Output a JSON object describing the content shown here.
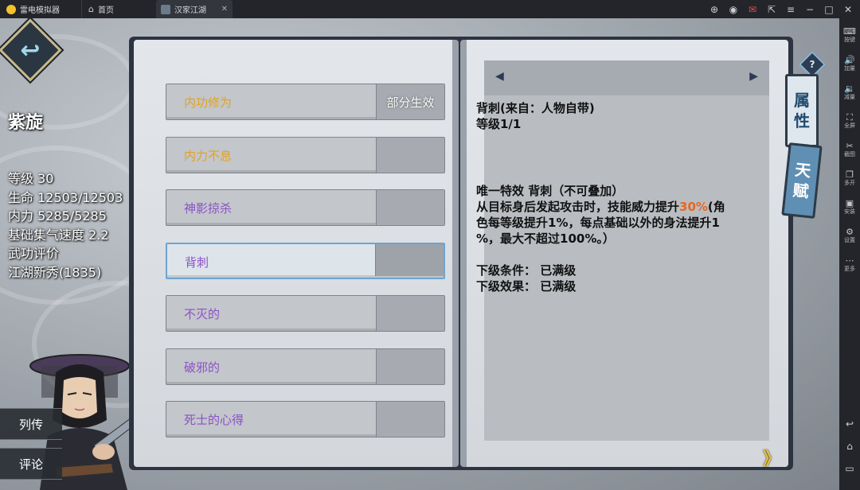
{
  "titlebar": {
    "app_name": "雷电模拟器",
    "home_tab": "首页",
    "game_tab": "汉家江湖",
    "close_glyph": "✕"
  },
  "sidebar": {
    "items": [
      {
        "icon": "keyboard-icon",
        "glyph": "⌨",
        "label": "按键"
      },
      {
        "icon": "volume-up-icon",
        "glyph": "🔊",
        "label": "加量"
      },
      {
        "icon": "volume-down-icon",
        "glyph": "🔉",
        "label": "减量"
      },
      {
        "icon": "fullscreen-icon",
        "glyph": "⛶",
        "label": "全屏"
      },
      {
        "icon": "scissors-icon",
        "glyph": "✂",
        "label": "截图"
      },
      {
        "icon": "multi-open-icon",
        "glyph": "❐",
        "label": "多开"
      },
      {
        "icon": "apk-install-icon",
        "glyph": "▣",
        "label": "安装"
      },
      {
        "icon": "gear-icon",
        "glyph": "⚙",
        "label": "设置"
      },
      {
        "icon": "more-icon",
        "glyph": "⋯",
        "label": "更多"
      }
    ],
    "nav": {
      "back": "↩",
      "home": "⌂",
      "recent": "▭"
    }
  },
  "game": {
    "back_glyph": "↩",
    "character": {
      "name": "紫旋",
      "stats": [
        "等级 30",
        "生命 12503/12503",
        "内力 5285/5285",
        "基础集气速度 2.2",
        "武功评价",
        "江湖新秀(1835)"
      ]
    },
    "side_buttons": {
      "bio": "列传",
      "comment": "评论"
    },
    "skills": [
      {
        "name": "内功修为",
        "status": "部分生效",
        "color": "#e3a21f",
        "selected": false
      },
      {
        "name": "内力不息",
        "status": "",
        "color": "#e3a21f",
        "selected": false
      },
      {
        "name": "神影掠杀",
        "status": "",
        "color": "#8a52c8",
        "selected": false
      },
      {
        "name": "背刺",
        "status": "",
        "color": "#8a52c8",
        "selected": true
      },
      {
        "name": "不灭的",
        "status": "",
        "color": "#8a52c8",
        "selected": false
      },
      {
        "name": "破邪的",
        "status": "",
        "color": "#8a52c8",
        "selected": false
      },
      {
        "name": "死士的心得",
        "status": "",
        "color": "#8a52c8",
        "selected": false
      }
    ],
    "detail": {
      "prev_glyph": "◀",
      "next_glyph": "▶",
      "title": "背刺(来自：人物自带)",
      "level": "等级1/1",
      "effect_title": "唯一特效 背刺（不可叠加）",
      "effect_pre": "从目标身后发起攻击时，技能威力提升",
      "effect_highlight": "30%",
      "effect_post": "(角",
      "effect_line2": "色每等级提升1%，每点基础以外的身法提升1",
      "effect_line3": "%，最大不超过100%。）",
      "next_condition": "下级条件： 已满级",
      "next_effect": "下级效果： 已满级"
    },
    "next_page_glyph": "》",
    "help_glyph": "?",
    "tabs": {
      "attr": [
        "属",
        "性"
      ],
      "talent": [
        "天",
        "赋"
      ]
    }
  }
}
